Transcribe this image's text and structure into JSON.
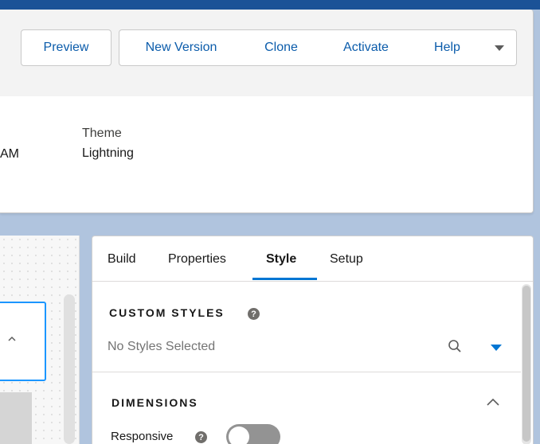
{
  "toolbar": {
    "buttons": [
      "Preview",
      "New Version",
      "Clone",
      "Activate",
      "Help"
    ],
    "more_icon": "chevron-down-icon"
  },
  "details": {
    "time_suffix": "AM",
    "theme_label": "Theme",
    "theme_value": "Lightning"
  },
  "panel": {
    "tabs": [
      {
        "label": "Build",
        "active": false
      },
      {
        "label": "Properties",
        "active": false
      },
      {
        "label": "Style",
        "active": true
      },
      {
        "label": "Setup",
        "active": false
      }
    ],
    "custom_styles": {
      "title": "CUSTOM STYLES",
      "help_glyph": "?",
      "placeholder": "No Styles Selected",
      "search_icon": "search-icon",
      "dropdown_icon": "triangle-down-icon"
    },
    "dimensions": {
      "title": "DIMENSIONS",
      "collapse_icon": "chevron-up-icon",
      "responsive_label": "Responsive",
      "help_glyph": "?",
      "responsive_enabled": false
    }
  },
  "colors": {
    "accent": "#0176d3",
    "link": "#0b5cab",
    "background": "#b0c4de"
  }
}
